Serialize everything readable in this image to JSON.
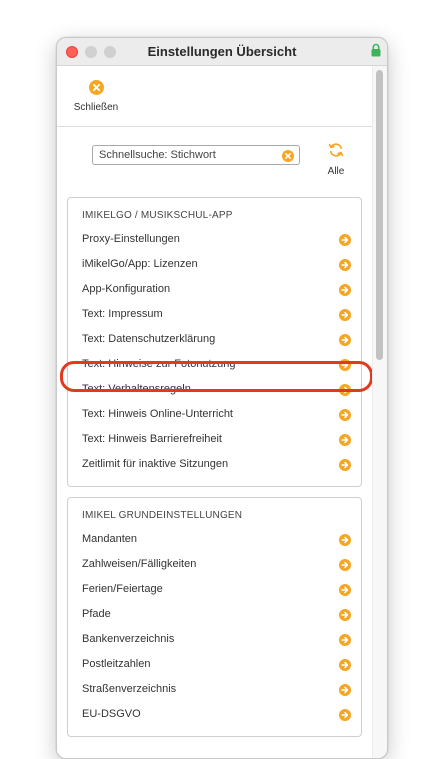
{
  "window": {
    "title": "Einstellungen Übersicht"
  },
  "toolbar": {
    "close_label": "Schließen"
  },
  "search": {
    "placeholder": "Schnellsuche: Stichwort",
    "all_label": "Alle"
  },
  "colors": {
    "accent_orange": "#f5a623",
    "highlight_red": "#e3391e",
    "close_red": "#ff5f57",
    "lock_green": "#3fb35a"
  },
  "groups": [
    {
      "title": "IMIKELGO / MUSIKSCHUL-APP",
      "items": [
        "Proxy-Einstellungen",
        "iMikelGo/App: Lizenzen",
        "App-Konfiguration",
        "Text: Impressum",
        "Text: Datenschutzerklärung",
        "Text: Hinweise zur Fotonutzung",
        "Text: Verhaltensregeln",
        "Text: Hinweis Online-Unterricht",
        "Text: Hinweis Barrierefreiheit",
        "Zeitlimit für inaktive Sitzungen"
      ]
    },
    {
      "title": "IMIKEL GRUNDEINSTELLUNGEN",
      "items": [
        "Mandanten",
        "Zahlweisen/Fälligkeiten",
        "Ferien/Feiertage",
        "Pfade",
        "Bankenverzeichnis",
        "Postleitzahlen",
        "Straßenverzeichnis",
        "EU-DSGVO"
      ]
    }
  ]
}
